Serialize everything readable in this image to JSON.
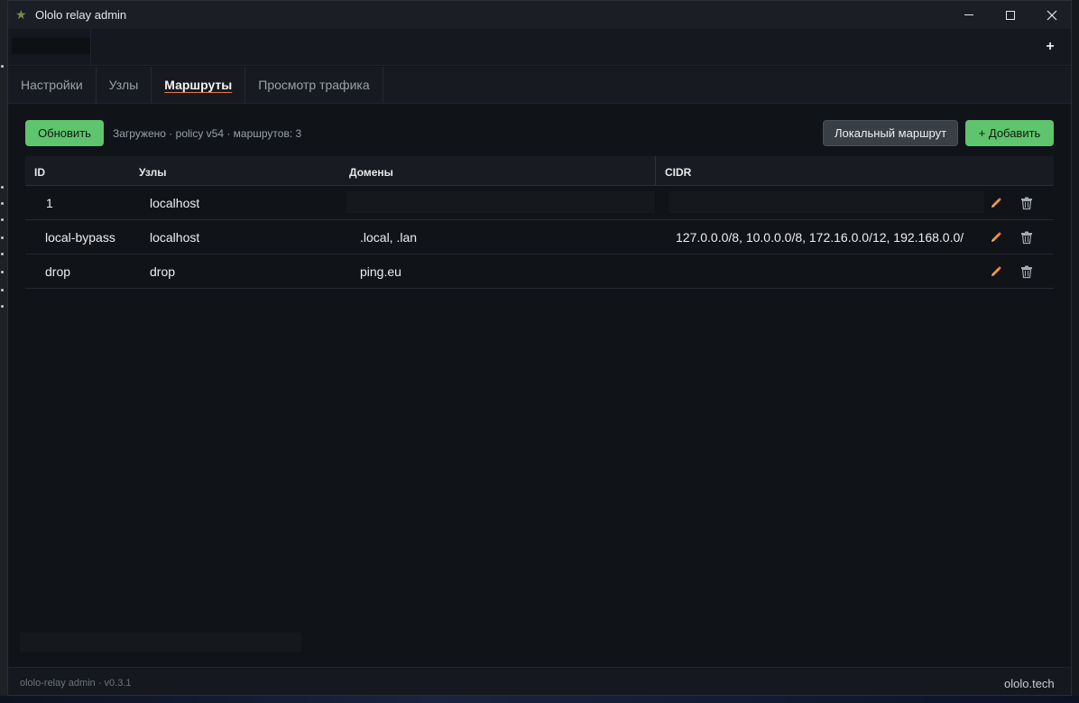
{
  "window": {
    "title": "Ololo relay admin"
  },
  "toolbar": {
    "plus_label": "+"
  },
  "tabs": [
    {
      "label": "Настройки",
      "active": false
    },
    {
      "label": "Узлы",
      "active": false
    },
    {
      "label": "Маршруты",
      "active": true
    },
    {
      "label": "Просмотр трафика",
      "active": false
    }
  ],
  "actions": {
    "refresh_label": "Обновить",
    "status": "Загружено · policy v54 · маршрутов: 3",
    "local_route_label": "Локальный маршрут",
    "add_label": "+ Добавить"
  },
  "table": {
    "columns": [
      "ID",
      "Узлы",
      "Домены",
      "CIDR"
    ],
    "rows": [
      {
        "id": "1",
        "nodes": "localhost",
        "domains": "",
        "cidr": ""
      },
      {
        "id": "local-bypass",
        "nodes": "localhost",
        "domains": ".local, .lan",
        "cidr": "127.0.0.0/8, 10.0.0.0/8, 172.16.0.0/12, 192.168.0.0/"
      },
      {
        "id": "drop",
        "nodes": "drop",
        "domains": "ping.eu",
        "cidr": ""
      }
    ]
  },
  "footer": {
    "version": "ololo-relay admin · v0.3.1",
    "brand": "ololo.tech"
  },
  "colors": {
    "accent_green": "#5fc46e",
    "active_tab_underline": "#e07b4f",
    "edit_icon": "#f0953a"
  }
}
